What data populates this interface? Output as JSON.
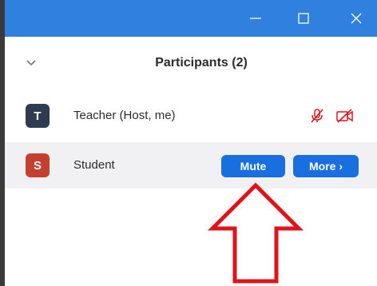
{
  "window": {
    "minimize_label": "Minimize",
    "maximize_label": "Maximize",
    "close_label": "Close",
    "accent_color": "#2f80df"
  },
  "panel": {
    "title": "Participants (2)"
  },
  "participants": [
    {
      "initial": "T",
      "name": "Teacher (Host, me)",
      "avatar_color": "#2f3c4f",
      "status_icons": [
        "mic-muted-icon",
        "video-off-icon"
      ]
    },
    {
      "initial": "S",
      "name": "Student",
      "avatar_color": "#c43f2f"
    }
  ],
  "actions": {
    "mute_label": "Mute",
    "more_label": "More",
    "more_chevron": "›",
    "button_color": "#1a6fe0"
  },
  "annotation": {
    "arrow_color": "#e0131a"
  }
}
